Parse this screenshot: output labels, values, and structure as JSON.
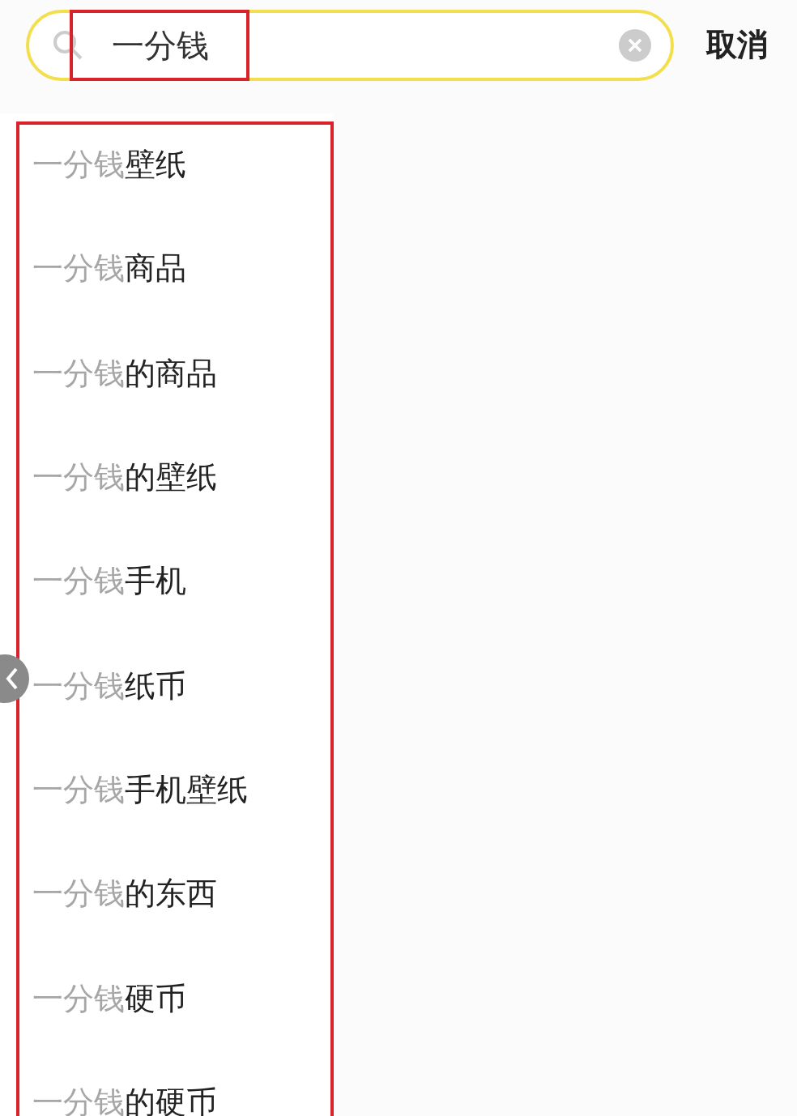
{
  "search": {
    "value": "一分钱",
    "cancel": "取消"
  },
  "suggestions": [
    {
      "highlight": "一分钱",
      "rest": "壁纸"
    },
    {
      "highlight": "一分钱",
      "rest": "商品"
    },
    {
      "highlight": "一分钱",
      "rest": "的商品"
    },
    {
      "highlight": "一分钱",
      "rest": "的壁纸"
    },
    {
      "highlight": "一分钱",
      "rest": "手机"
    },
    {
      "highlight": "一分钱",
      "rest": "纸币"
    },
    {
      "highlight": "一分钱",
      "rest": "手机壁纸"
    },
    {
      "highlight": "一分钱",
      "rest": "的东西"
    },
    {
      "highlight": "一分钱",
      "rest": "硬币"
    },
    {
      "highlight": "一分钱",
      "rest": "的硬币"
    }
  ]
}
